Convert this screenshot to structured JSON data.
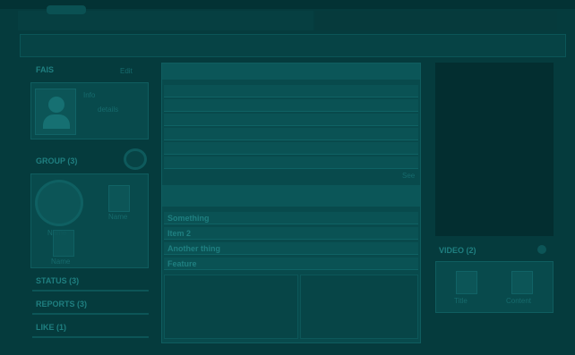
{
  "colors": {
    "background": "#053b3d",
    "panel": "#084a4c",
    "accent": "#1f7f80"
  },
  "header": {
    "logo_text": ""
  },
  "left": {
    "section1": {
      "title": "FAIS",
      "action": "Edit"
    },
    "profile": {
      "name": "Info",
      "detail": "details"
    },
    "section2": {
      "title": "GROUP (3)"
    },
    "group": {
      "member1": "Name",
      "member2": "Name",
      "member3": "Name"
    },
    "stats": [
      {
        "label": "STATUS (3)"
      },
      {
        "label": "REPORTS (3)"
      },
      {
        "label": "LIKE (1)"
      }
    ]
  },
  "middle": {
    "list_items": [
      "",
      "",
      "",
      "",
      "",
      ""
    ],
    "more": "See",
    "links": [
      "Something",
      "Item 2",
      "Another thing",
      "Feature"
    ]
  },
  "right": {
    "section_title": "VIDEO (2)",
    "tiles": [
      {
        "label": "Title"
      },
      {
        "label": "Content"
      }
    ]
  }
}
